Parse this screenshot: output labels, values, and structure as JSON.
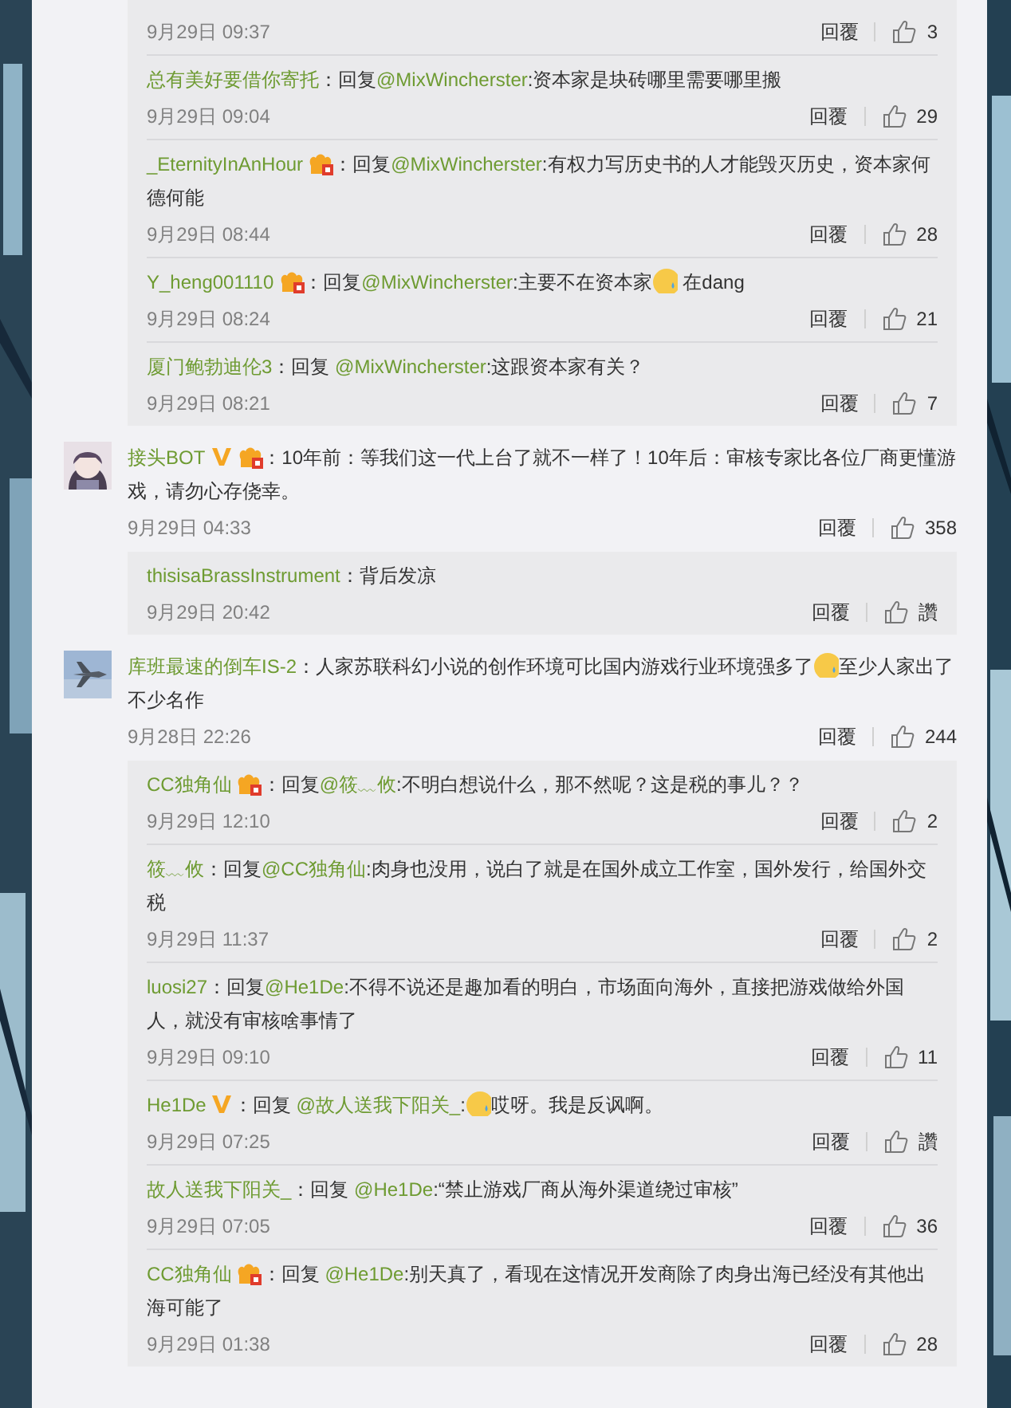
{
  "threads": [
    {
      "kind": "replies",
      "items": [
        {
          "date": "9月29日 09:37",
          "reply_label": "回覆",
          "likes": "3"
        },
        {
          "name": "总有美好要借你寄托",
          "verified": false,
          "member": false,
          "segments": [
            {
              "kind": "text",
              "text": "：回复"
            },
            {
              "kind": "mention",
              "text": "@MixWincherster"
            },
            {
              "kind": "text",
              "text": ":资本家是块砖哪里需要哪里搬"
            }
          ],
          "date": "9月29日 09:04",
          "reply_label": "回覆",
          "likes": "29"
        },
        {
          "name": "_EternityInAnHour",
          "verified": false,
          "member": true,
          "segments": [
            {
              "kind": "text",
              "text": "：回复"
            },
            {
              "kind": "mention",
              "text": "@MixWincherster"
            },
            {
              "kind": "text",
              "text": ":有权力写历史书的人才能毁灭历史，资本家何德何能"
            }
          ],
          "date": "9月29日 08:44",
          "reply_label": "回覆",
          "likes": "28"
        },
        {
          "name": "Y_heng001110",
          "verified": false,
          "member": true,
          "segments": [
            {
              "kind": "text",
              "text": "：回复"
            },
            {
              "kind": "mention",
              "text": "@MixWincherster"
            },
            {
              "kind": "text",
              "text": ":主要不在资本家"
            },
            {
              "kind": "emoji"
            },
            {
              "kind": "text",
              "text": " 在dang"
            }
          ],
          "date": "9月29日 08:24",
          "reply_label": "回覆",
          "likes": "21"
        },
        {
          "name": "厦门鲍勃迪伦3",
          "verified": false,
          "member": false,
          "segments": [
            {
              "kind": "text",
              "text": "：回复 "
            },
            {
              "kind": "mention",
              "text": "@MixWincherster"
            },
            {
              "kind": "text",
              "text": ":这跟资本家有关？"
            }
          ],
          "date": "9月29日 08:21",
          "reply_label": "回覆",
          "likes": "7"
        }
      ]
    },
    {
      "kind": "comment",
      "name": "接头BOT",
      "verified": true,
      "member": true,
      "segments": [
        {
          "kind": "text",
          "text": "：10年前：等我们这一代上台了就不一样了！10年后：审核专家比各位厂商更懂游戏，请勿心存侥幸。"
        }
      ],
      "date": "9月29日 04:33",
      "reply_label": "回覆",
      "likes": "358"
    },
    {
      "kind": "replies",
      "items": [
        {
          "name": "thisisaBrassInstrument",
          "verified": false,
          "member": false,
          "segments": [
            {
              "kind": "text",
              "text": "：背后发凉"
            }
          ],
          "date": "9月29日 20:42",
          "reply_label": "回覆",
          "likes": "讚"
        }
      ]
    },
    {
      "kind": "comment",
      "name": "库班最速的倒车IS-2",
      "verified": false,
      "member": false,
      "segments": [
        {
          "kind": "text",
          "text": "：人家苏联科幻小说的创作环境可比国内游戏行业环境强多了"
        },
        {
          "kind": "emoji"
        },
        {
          "kind": "text",
          "text": "至少人家出了不少名作"
        }
      ],
      "date": "9月28日 22:26",
      "reply_label": "回覆",
      "likes": "244"
    },
    {
      "kind": "replies",
      "items": [
        {
          "name": "CC独角仙",
          "verified": false,
          "member": true,
          "segments": [
            {
              "kind": "text",
              "text": "：回复"
            },
            {
              "kind": "mention",
              "text": "@筱﹏攸"
            },
            {
              "kind": "text",
              "text": ":不明白想说什么，那不然呢？这是税的事儿？？"
            }
          ],
          "date": "9月29日 12:10",
          "reply_label": "回覆",
          "likes": "2"
        },
        {
          "name": "筱﹏攸",
          "verified": false,
          "member": false,
          "segments": [
            {
              "kind": "text",
              "text": "：回复"
            },
            {
              "kind": "mention",
              "text": "@CC独角仙"
            },
            {
              "kind": "text",
              "text": ":肉身也没用，说白了就是在国外成立工作室，国外发行，给国外交税"
            }
          ],
          "date": "9月29日 11:37",
          "reply_label": "回覆",
          "likes": "2"
        },
        {
          "name": "luosi27",
          "verified": false,
          "member": false,
          "segments": [
            {
              "kind": "text",
              "text": "：回复"
            },
            {
              "kind": "mention",
              "text": "@He1De"
            },
            {
              "kind": "text",
              "text": ":不得不说还是趣加看的明白，市场面向海外，直接把游戏做给外国人，就没有审核啥事情了"
            }
          ],
          "date": "9月29日 09:10",
          "reply_label": "回覆",
          "likes": "11"
        },
        {
          "name": "He1De",
          "verified": true,
          "member": false,
          "segments": [
            {
              "kind": "text",
              "text": "：回复 "
            },
            {
              "kind": "mention",
              "text": "@故人送我下阳关_"
            },
            {
              "kind": "text",
              "text": ":"
            },
            {
              "kind": "emoji"
            },
            {
              "kind": "text",
              "text": "哎呀。我是反讽啊。"
            }
          ],
          "date": "9月29日 07:25",
          "reply_label": "回覆",
          "likes": "讚"
        },
        {
          "name": "故人送我下阳关_",
          "verified": false,
          "member": false,
          "segments": [
            {
              "kind": "text",
              "text": "：回复 "
            },
            {
              "kind": "mention",
              "text": "@He1De"
            },
            {
              "kind": "text",
              "text": ":“禁止游戏厂商从海外渠道绕过审核”"
            }
          ],
          "date": "9月29日 07:05",
          "reply_label": "回覆",
          "likes": "36"
        },
        {
          "name": "CC独角仙",
          "verified": false,
          "member": true,
          "segments": [
            {
              "kind": "text",
              "text": "：回复 "
            },
            {
              "kind": "mention",
              "text": "@He1De"
            },
            {
              "kind": "text",
              "text": ":别天真了，看现在这情况开发商除了肉身出海已经没有其他出海可能了"
            }
          ],
          "date": "9月29日 01:38",
          "reply_label": "回覆",
          "likes": "28"
        }
      ]
    }
  ]
}
